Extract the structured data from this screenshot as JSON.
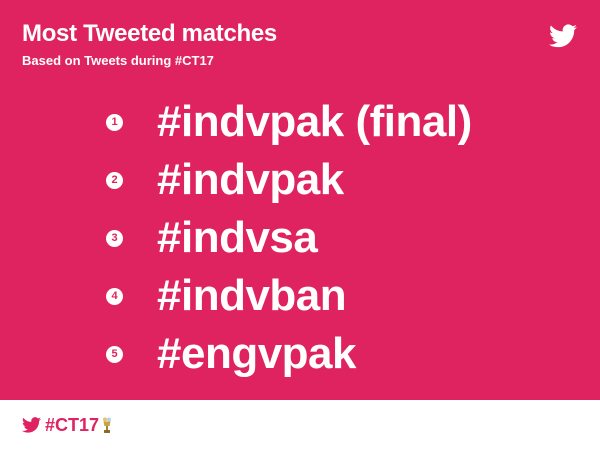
{
  "header": {
    "title": "Most Tweeted matches",
    "subtitle": "Based on Tweets during #CT17",
    "bird_icon": "twitter-bird-icon"
  },
  "ranking": [
    {
      "rank": "1",
      "tag": "#indvpak (final)"
    },
    {
      "rank": "2",
      "tag": "#indvpak"
    },
    {
      "rank": "3",
      "tag": "#indvsa"
    },
    {
      "rank": "4",
      "tag": "#indvban"
    },
    {
      "rank": "5",
      "tag": "#engvpak"
    }
  ],
  "footer": {
    "hashtag": "#CT17",
    "bird_icon": "twitter-bird-icon",
    "trophy_icon": "trophy-emoji-icon"
  },
  "colors": {
    "background": "#df2260",
    "text": "#ffffff",
    "footer_background": "#ffffff",
    "footer_accent": "#df2260",
    "trophy": "#c9a24a"
  }
}
